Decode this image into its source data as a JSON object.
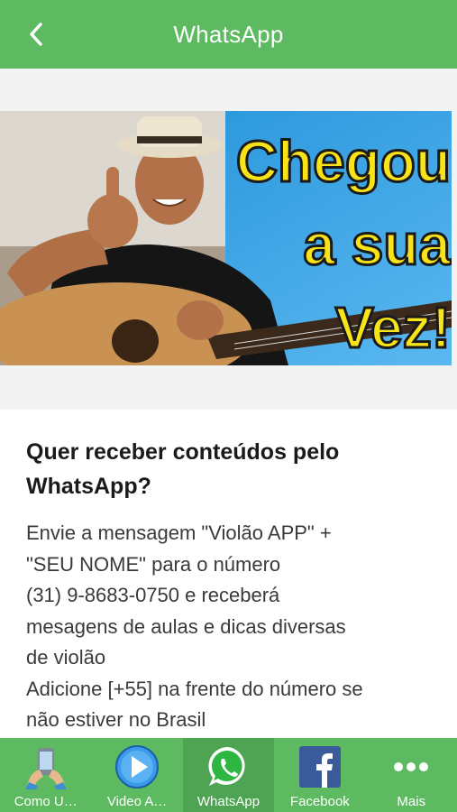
{
  "header": {
    "title": "WhatsApp",
    "back_icon": "chevron-left-icon"
  },
  "hero": {
    "banner_lines": [
      "Chegou",
      "a sua",
      "Vez!"
    ],
    "colors": {
      "sky": "#2b9be2",
      "text_fill": "#f7e318",
      "text_stroke": "#1a1a1a"
    }
  },
  "article": {
    "heading_lines": [
      "Quer receber conteúdos pelo",
      "WhatsApp?"
    ],
    "body_lines": [
      "Envie a mensagem \"Violão APP\" +",
      "\"SEU NOME\" para o número",
      "(31) 9-8683-0750 e receberá",
      "mesagens de aulas e dicas diversas",
      "de violão",
      "Adicione [+55] na frente do número se",
      "não estiver no Brasil"
    ]
  },
  "tabbar": {
    "active_index": 2,
    "tabs": [
      {
        "label": "Como U…",
        "icon": "phone-hands-icon"
      },
      {
        "label": "Video A…",
        "icon": "play-icon"
      },
      {
        "label": "WhatsApp",
        "icon": "whatsapp-icon"
      },
      {
        "label": "Facebook",
        "icon": "facebook-icon"
      },
      {
        "label": "Mais",
        "icon": "more-dots-icon"
      }
    ]
  },
  "colors": {
    "accent": "#5dba60",
    "active_tab": "#4ea452"
  }
}
